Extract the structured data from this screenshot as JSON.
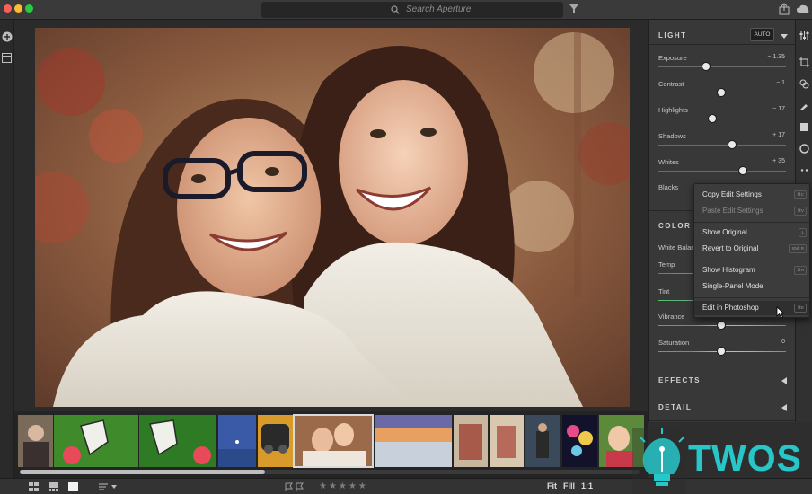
{
  "search": {
    "placeholder": "Search Aperture"
  },
  "panel": {
    "light": {
      "title": "LIGHT",
      "auto_label": "AUTO",
      "sliders": [
        {
          "label": "Exposure",
          "value": "− 1.35"
        },
        {
          "label": "Contrast",
          "value": "− 1"
        },
        {
          "label": "Highlights",
          "value": "− 17"
        },
        {
          "label": "Shadows",
          "value": "+ 17"
        },
        {
          "label": "Whites",
          "value": "+ 35"
        },
        {
          "label": "Blacks",
          "value": ""
        }
      ]
    },
    "color": {
      "title": "COLOR",
      "white_balance_label": "White Balance",
      "sliders": [
        {
          "label": "Temp",
          "value": ""
        },
        {
          "label": "Tint",
          "value": ""
        },
        {
          "label": "Vibrance",
          "value": ""
        },
        {
          "label": "Saturation",
          "value": "0"
        }
      ]
    },
    "effects": {
      "title": "EFFECTS"
    },
    "detail": {
      "title": "DETAIL"
    }
  },
  "context_menu": {
    "items": [
      {
        "label": "Copy Edit Settings",
        "shortcut": "⌘C",
        "enabled": true
      },
      {
        "label": "Paste Edit Settings",
        "shortcut": "⌘V",
        "enabled": false
      },
      {
        "label": "Show Original",
        "shortcut": "L",
        "enabled": true
      },
      {
        "label": "Revert to Original",
        "shortcut": "Shift R",
        "enabled": true
      },
      {
        "label": "Show Histogram",
        "shortcut": "⌘H",
        "enabled": true
      },
      {
        "label": "Single-Panel Mode",
        "shortcut": "",
        "enabled": true
      },
      {
        "label": "Edit in Photoshop",
        "shortcut": "⌘E",
        "enabled": true
      }
    ]
  },
  "bottombar": {
    "stars": "★★★★★",
    "zoom_fit": "Fit",
    "zoom_fill": "Fill",
    "zoom_1to1": "1:1"
  },
  "watermark": {
    "text": "TWOS"
  },
  "colors": {
    "accent": "#27c7c9",
    "panel_bg": "#383838",
    "menu_bg": "#3c3c3c"
  }
}
